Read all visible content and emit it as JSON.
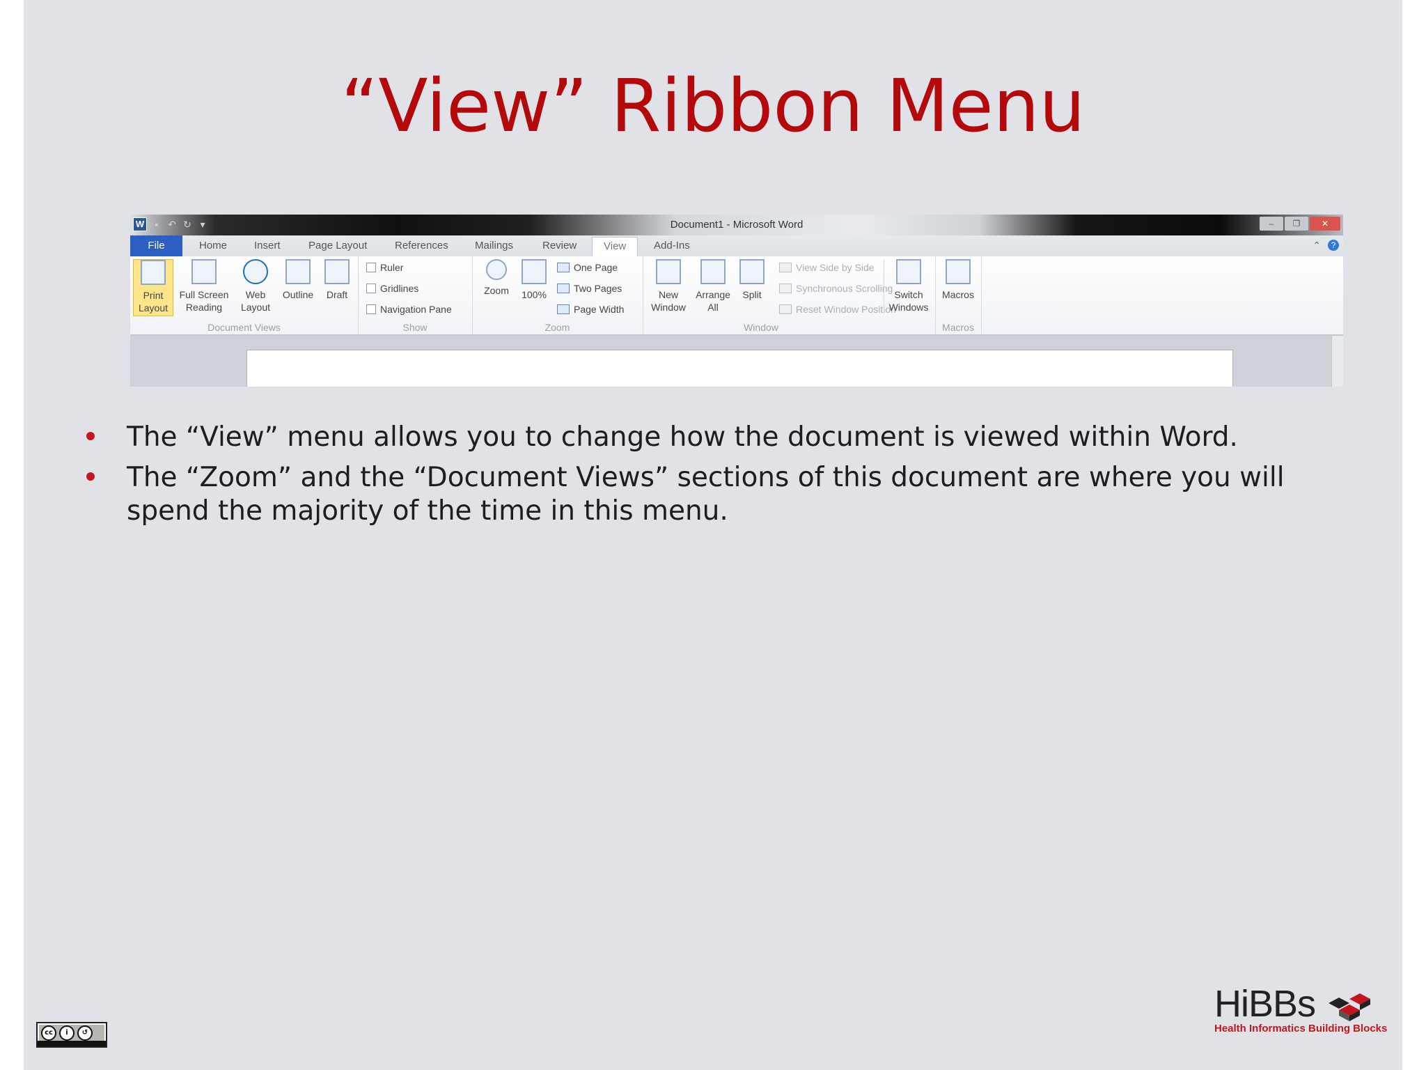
{
  "slide": {
    "title": "“View” Ribbon Menu",
    "bullets": [
      "The “View” menu allows you to change how the document is viewed within Word.",
      "The “Zoom” and the “Document Views” sections of this document are where you will spend the majority of the time in this menu."
    ]
  },
  "word_window": {
    "title": "Document1 - Microsoft Word",
    "tabs": [
      "File",
      "Home",
      "Insert",
      "Page Layout",
      "References",
      "Mailings",
      "Review",
      "View",
      "Add-Ins"
    ],
    "active_tab": "View",
    "groups": {
      "document_views": {
        "label": "Document Views",
        "buttons": [
          "Print Layout",
          "Full Screen Reading",
          "Web Layout",
          "Outline",
          "Draft"
        ],
        "selected": "Print Layout"
      },
      "show": {
        "label": "Show",
        "checkboxes": [
          "Ruler",
          "Gridlines",
          "Navigation Pane"
        ]
      },
      "zoom": {
        "label": "Zoom",
        "buttons": [
          "Zoom",
          "100%"
        ],
        "small_buttons": [
          "One Page",
          "Two Pages",
          "Page Width"
        ]
      },
      "window": {
        "label": "Window",
        "buttons": [
          "New Window",
          "Arrange All",
          "Split"
        ],
        "small_buttons": [
          "View Side by Side",
          "Synchronous Scrolling",
          "Reset Window Position"
        ],
        "switch_windows": "Switch Windows"
      },
      "macros": {
        "label": "Macros",
        "button": "Macros"
      }
    }
  },
  "footer": {
    "logo_word": "HiBBs",
    "logo_tagline": "Health Informatics Building Blocks",
    "license_badge": "CC BY SA",
    "colors": {
      "accent": "#c0161c",
      "title": "#b3090b",
      "background": "#e1e1e8"
    }
  }
}
